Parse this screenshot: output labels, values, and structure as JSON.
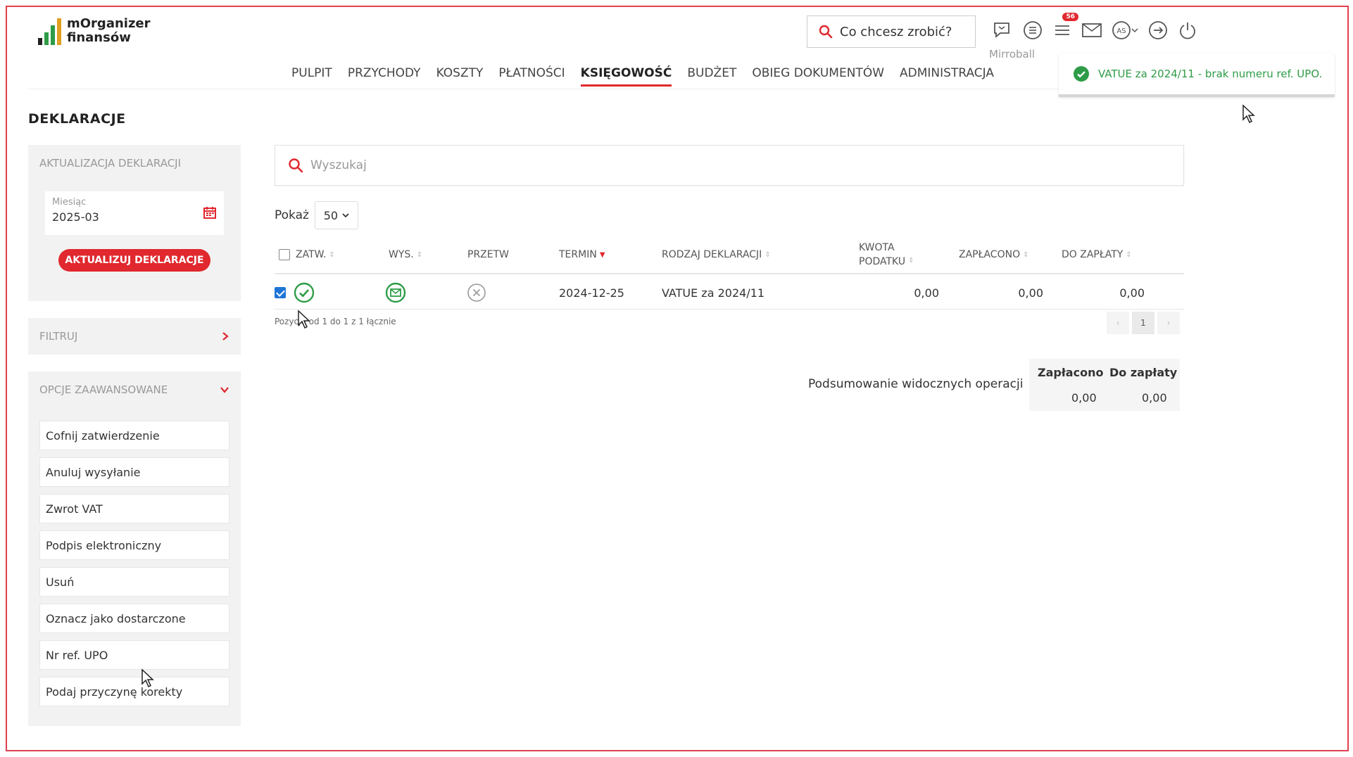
{
  "app": {
    "logo_line1": "mOrganizer",
    "logo_line2": "finansów",
    "logo_bar_colors": [
      "#e0282e",
      "#2e9c47",
      "#2e9c47",
      "#2e9c47"
    ]
  },
  "header": {
    "quick_search": "Co chcesz zrobić?",
    "user_label": "Mirroball",
    "notification_count": "56",
    "icons": [
      "chat-icon",
      "list-circle-icon",
      "notifications-list-icon",
      "mail-icon",
      "user-avatar-icon",
      "logout-icon",
      "power-icon"
    ]
  },
  "nav": {
    "items": [
      "PULPIT",
      "PRZYCHODY",
      "KOSZTY",
      "PŁATNOŚCI",
      "KSIĘGOWOŚĆ",
      "BUDŻET",
      "OBIEG DOKUMENTÓW",
      "ADMINISTRACJA"
    ],
    "active": "KSIĘGOWOŚĆ"
  },
  "toast": {
    "message": "VATUE za 2024/11 - brak numeru ref. UPO.",
    "color": "#2e9c47"
  },
  "page": {
    "title": "DEKLARACJE"
  },
  "sidebar": {
    "update_panel": {
      "title": "AKTUALIZACJA DEKLARACJI",
      "month_label": "Miesiąc",
      "month_value": "2025-03",
      "button": "AKTUALIZUJ DEKLARACJE"
    },
    "filter_title": "FILTRUJ",
    "advanced_title": "OPCJE ZAAWANSOWANE",
    "advanced_items": [
      "Cofnij zatwierdzenie",
      "Anuluj wysyłanie",
      "Zwrot VAT",
      "Podpis elektroniczny",
      "Usuń",
      "Oznacz jako dostarczone",
      "Nr ref. UPO",
      "Podaj przyczynę korekty"
    ]
  },
  "main": {
    "search_placeholder": "Wyszukaj",
    "show_label": "Pokaż",
    "show_value": "50",
    "columns": {
      "zatw": "ZATW.",
      "wys": "WYS.",
      "przetw": "PRZETW",
      "termin": "TERMIN",
      "rodzaj": "RODZAJ DEKLARACJI",
      "kwota_1": "KWOTA",
      "kwota_2": "PODATKU",
      "zaplacono": "ZAPŁACONO",
      "do_zaplaty": "DO ZAPŁATY"
    },
    "rows": [
      {
        "termin": "2024-12-25",
        "rodzaj": "VATUE za 2024/11",
        "kwota": "0,00",
        "zaplacono": "0,00",
        "do_zaplaty": "0,00"
      }
    ],
    "info_text": "Pozycje od 1 do 1 z 1 łącznie",
    "pager": {
      "prev": "‹",
      "current": "1",
      "next": "›"
    },
    "summary": {
      "label": "Podsumowanie widocznych operacji",
      "paid_header": "Zapłacono",
      "due_header": "Do zapłaty",
      "paid_value": "0,00",
      "due_value": "0,00"
    }
  }
}
